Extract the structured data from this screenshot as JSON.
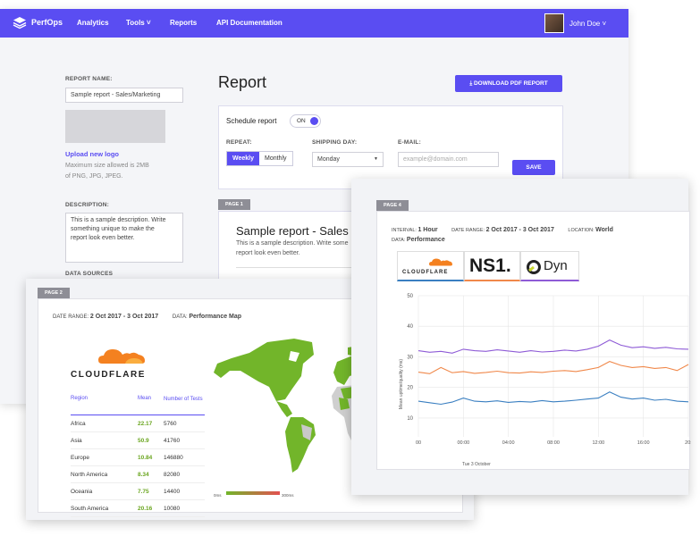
{
  "nav": {
    "brand": "PerfOps",
    "items": [
      "Analytics",
      "Tools ˅",
      "Reports",
      "API Documentation"
    ],
    "user_name": "John Doe ˅"
  },
  "sidebar": {
    "report_name_label": "REPORT NAME:",
    "report_name_value": "Sample report - Sales/Marketing",
    "upload_link": "Upload new logo",
    "upload_hint_1": "Maximum size allowed is 2MB",
    "upload_hint_2": "of PNG, JPG, JPEG.",
    "description_label": "DESCRIPTION:",
    "description_text_1": "This is a sample description. Write",
    "description_text_2": "something unique to make the",
    "description_text_3": "report look even better.",
    "data_sources_label": "DATA SOURCES"
  },
  "report": {
    "title": "Report",
    "download_btn": "⤓ DOWNLOAD PDF REPORT",
    "schedule_label": "Schedule report",
    "toggle_label": "ON",
    "repeat_label": "REPEAT:",
    "repeat_options": [
      "Weekly",
      "Monthly"
    ],
    "shipping_label": "SHIPPING DAY:",
    "shipping_value": "Monday",
    "email_label": "E-MAIL:",
    "email_placeholder": "example@domain.com",
    "save_btn": "SAVE",
    "page1_tab": "PAGE 1",
    "page1_title": "Sample report - Sales",
    "page1_desc_1": "This is a sample description. Write some",
    "page1_desc_2": "report look even better."
  },
  "page2": {
    "tab": "PAGE 2",
    "date_range_label": "DATE RANGE:",
    "date_range_value": "2 Oct 2017 - 3 Oct 2017",
    "data_label": "DATA:",
    "data_value": "Performance Map",
    "provider": "CLOUDFLARE",
    "table_headers": [
      "Region",
      "Mean",
      "Number of Tests"
    ],
    "rows": [
      {
        "region": "Africa",
        "mean": "22.17",
        "tests": "5760"
      },
      {
        "region": "Asia",
        "mean": "50.9",
        "tests": "41760"
      },
      {
        "region": "Europe",
        "mean": "10.84",
        "tests": "146880"
      },
      {
        "region": "North America",
        "mean": "8.34",
        "tests": "82080"
      },
      {
        "region": "Oceania",
        "mean": "7.75",
        "tests": "14400"
      },
      {
        "region": "South America",
        "mean": "20.16",
        "tests": "10080"
      }
    ],
    "legend_min": "0ms",
    "legend_max": "300ms"
  },
  "page4": {
    "tab": "PAGE 4",
    "interval_label": "INTERVAL:",
    "interval_value": "1 Hour",
    "date_range_label": "DATE RANGE:",
    "date_range_value": "2 Oct 2017 - 3 Oct 2017",
    "location_label": "LOCATION:",
    "location_value": "World",
    "data_label": "DATA:",
    "data_value": "Performance",
    "providers": [
      "CLOUDFLARE",
      "NS1.",
      "Dyn"
    ],
    "provider_colors": [
      "#f48120",
      "#1a1a1a",
      "#222222"
    ]
  },
  "chart_data": {
    "type": "line",
    "ylabel": "Mean uptime/quality (ms)",
    "ylim": [
      5,
      50
    ],
    "yticks": [
      10,
      20,
      30,
      40,
      50
    ],
    "xticks": [
      "00",
      "00:00",
      "04:00",
      "08:00",
      "12:00",
      "16:00",
      "20:"
    ],
    "x_sublabel": "Tue 3 October",
    "x": [
      0,
      1,
      2,
      3,
      4,
      5,
      6,
      7,
      8,
      9,
      10,
      11,
      12,
      13,
      14,
      15,
      16,
      17,
      18,
      19,
      20,
      21,
      22,
      23,
      24
    ],
    "series": [
      {
        "color": "#8e5bd6",
        "values": [
          32,
          31.5,
          31.8,
          31.2,
          32.5,
          32,
          31.8,
          32.3,
          31.9,
          31.5,
          32,
          31.6,
          31.8,
          32.2,
          31.9,
          32.5,
          33.5,
          35.5,
          33.8,
          33,
          33.3,
          32.8,
          33.1,
          32.6,
          32.5
        ]
      },
      {
        "color": "#f0884a",
        "values": [
          25,
          24.5,
          26.5,
          24.8,
          25.2,
          24.6,
          24.9,
          25.3,
          24.8,
          24.7,
          25.1,
          24.9,
          25.3,
          25.5,
          25.2,
          25.8,
          26.5,
          28.5,
          27.2,
          26.5,
          26.8,
          26.2,
          26.5,
          25.5,
          27.5
        ]
      },
      {
        "color": "#3a7fc1",
        "values": [
          15.5,
          15,
          14.5,
          15.2,
          16.5,
          15.5,
          15.3,
          15.6,
          15.1,
          15.4,
          15.2,
          15.7,
          15.3,
          15.5,
          15.8,
          16.2,
          16.5,
          18.5,
          16.8,
          16.2,
          16.5,
          15.8,
          16.1,
          15.5,
          15.3
        ]
      }
    ]
  }
}
